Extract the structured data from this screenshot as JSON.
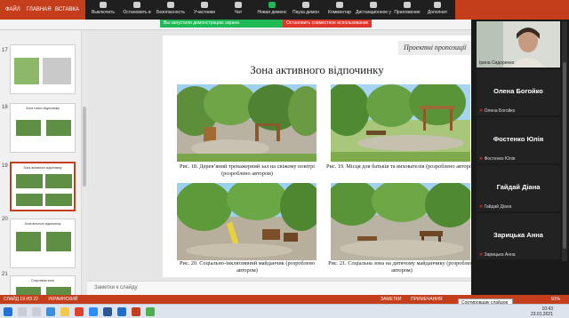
{
  "ribbon": {
    "tabs": [
      "ФАЙЛ",
      "ГЛАВНАЯ",
      "ВСТАВКА"
    ]
  },
  "zoom_toolbar": {
    "items": [
      "Выключить",
      "Остановить в",
      "Безопасность",
      "Участники",
      "Чат",
      "Новая демонс",
      "Пауза демон",
      "Комментар",
      "Дистанционное у",
      "Приложение",
      "Дополнит"
    ]
  },
  "share_banner": {
    "status": "Вы запустили демонстрацию экрана",
    "stop": "Остановить совместное использование"
  },
  "thumbnails": {
    "numbers": [
      "17",
      "18",
      "19",
      "20",
      "21"
    ],
    "selected": "19",
    "t17_title": "",
    "t18_title": "Зона тихого відпочинку",
    "t19_title": "Зона активного відпочинку",
    "t20_title": "Зона вільного відпочинку",
    "t21_title": "Спортивна зона"
  },
  "slide": {
    "banner": "Проектні пропозиції",
    "title": "Зона активного відпочинку",
    "captions": [
      "Рис. 18. Дерев’яний тренажерний зал на свіжому повітрі (розроблено автором)",
      "Рис. 19. Місця для батьків та вихователів (розроблено автором)",
      "Рис. 20. Соціально-інклюзивний майданчик (розроблено автором)",
      "Рис. 21. Соціальна зона на дитячому майданчику (розроблено автором)"
    ]
  },
  "notes": {
    "placeholder": "Заметки к слайду"
  },
  "participants": [
    {
      "name": "",
      "label": "Ірина Сидоренко",
      "video": true
    },
    {
      "name": "Олена Богойко",
      "label": "Олена Богойко"
    },
    {
      "name": "Фостенко Юлія",
      "label": "Фостенко Юлія"
    },
    {
      "name": "Гайдай Діана",
      "label": "Гайдай Діана"
    },
    {
      "name": "Зарицька Анна",
      "label": "Зарицька Анна"
    }
  ],
  "statusbar": {
    "slide_info": "СЛАЙД 19 ИЗ 22",
    "language": "УКРАИНСКИЙ",
    "notes": "ЗАМЕТКИ",
    "comments": "ПРИМЕЧАНИЯ",
    "zoom": "91%"
  },
  "tooltip": "Сортировщик слайдов",
  "clock": {
    "time": "10:43",
    "date": "23.01.2021"
  },
  "colors": {
    "powerpoint": "#c43e1c",
    "zoom_green": "#1db954",
    "zoom_red": "#e0352b"
  }
}
